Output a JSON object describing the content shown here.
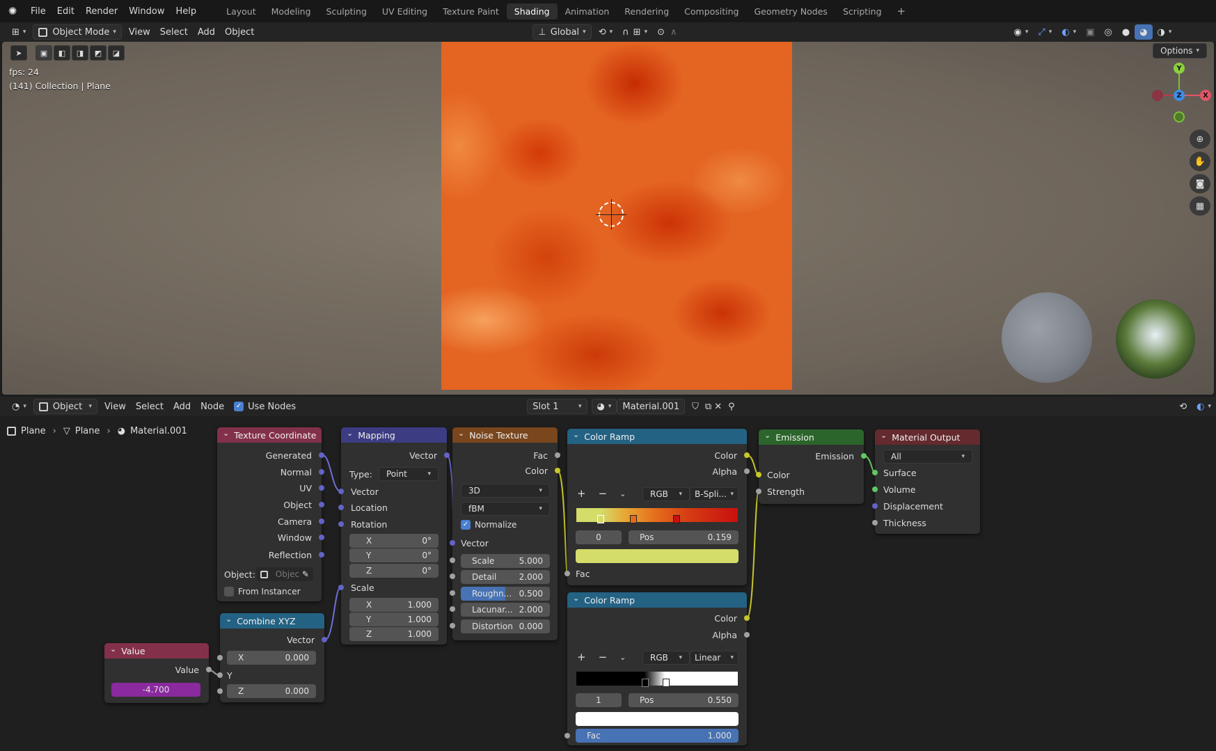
{
  "topbar": {
    "menus": [
      "File",
      "Edit",
      "Render",
      "Window",
      "Help"
    ],
    "workspaces": [
      "Layout",
      "Modeling",
      "Sculpting",
      "UV Editing",
      "Texture Paint",
      "Shading",
      "Animation",
      "Rendering",
      "Compositing",
      "Geometry Nodes",
      "Scripting"
    ],
    "active_workspace": "Shading",
    "add_tab": "+"
  },
  "viewport_header": {
    "mode": "Object Mode",
    "menus": [
      "View",
      "Select",
      "Add",
      "Object"
    ],
    "orientation": "Global",
    "options": "Options"
  },
  "viewport": {
    "fps": "fps: 24",
    "collection": "(141) Collection | Plane",
    "gizmo": {
      "x": "X",
      "y": "Y",
      "z": "Z"
    }
  },
  "node_header": {
    "editor_type": "Object",
    "menus": [
      "View",
      "Select",
      "Add",
      "Node"
    ],
    "use_nodes": "Use Nodes",
    "slot": "Slot 1",
    "material": "Material.001"
  },
  "breadcrumb": [
    "Plane",
    "Plane",
    "Material.001"
  ],
  "nodes": {
    "texcoord": {
      "title": "Texture Coordinate",
      "outputs": [
        "Generated",
        "Normal",
        "UV",
        "Object",
        "Camera",
        "Window",
        "Reflection"
      ],
      "object_label": "Object:",
      "object_placeholder": "Objec",
      "from_instancer": "From Instancer"
    },
    "mapping": {
      "title": "Mapping",
      "out_vector": "Vector",
      "type_label": "Type:",
      "type_value": "Point",
      "in_vector": "Vector",
      "location": "Location",
      "rotation": "Rotation",
      "rot": [
        {
          "a": "X",
          "v": "0°"
        },
        {
          "a": "Y",
          "v": "0°"
        },
        {
          "a": "Z",
          "v": "0°"
        }
      ],
      "scale": "Scale",
      "scl": [
        {
          "a": "X",
          "v": "1.000"
        },
        {
          "a": "Y",
          "v": "1.000"
        },
        {
          "a": "Z",
          "v": "1.000"
        }
      ]
    },
    "noise": {
      "title": "Noise Texture",
      "fac": "Fac",
      "color": "Color",
      "dim": "3D",
      "type": "fBM",
      "normalize": "Normalize",
      "vector": "Vector",
      "params": [
        {
          "n": "Scale",
          "v": "5.000"
        },
        {
          "n": "Detail",
          "v": "2.000"
        },
        {
          "n": "Roughn...",
          "v": "0.500"
        },
        {
          "n": "Lacunar...",
          "v": "2.000"
        },
        {
          "n": "Distortion",
          "v": "0.000"
        }
      ]
    },
    "ramp1": {
      "title": "Color Ramp",
      "color": "Color",
      "alpha": "Alpha",
      "mode": "RGB",
      "interp": "B-Spli...",
      "index": "0",
      "pos_label": "Pos",
      "pos": "0.159",
      "fac": "Fac",
      "swatch": "#d4dc6a"
    },
    "ramp2": {
      "title": "Color Ramp",
      "color": "Color",
      "alpha": "Alpha",
      "mode": "RGB",
      "interp": "Linear",
      "index": "1",
      "pos_label": "Pos",
      "pos": "0.550",
      "fac": "Fac",
      "fac_value": "1.000",
      "swatch": "#ffffff"
    },
    "emission": {
      "title": "Emission",
      "out": "Emission",
      "color": "Color",
      "strength": "Strength"
    },
    "output": {
      "title": "Material Output",
      "target": "All",
      "surface": "Surface",
      "volume": "Volume",
      "displacement": "Displacement",
      "thickness": "Thickness"
    },
    "combine": {
      "title": "Combine XYZ",
      "out": "Vector",
      "x_label": "X",
      "x": "0.000",
      "y_label": "Y",
      "z_label": "Z",
      "z": "0.000"
    },
    "value": {
      "title": "Value",
      "out": "Value",
      "value": "-4.700"
    }
  }
}
